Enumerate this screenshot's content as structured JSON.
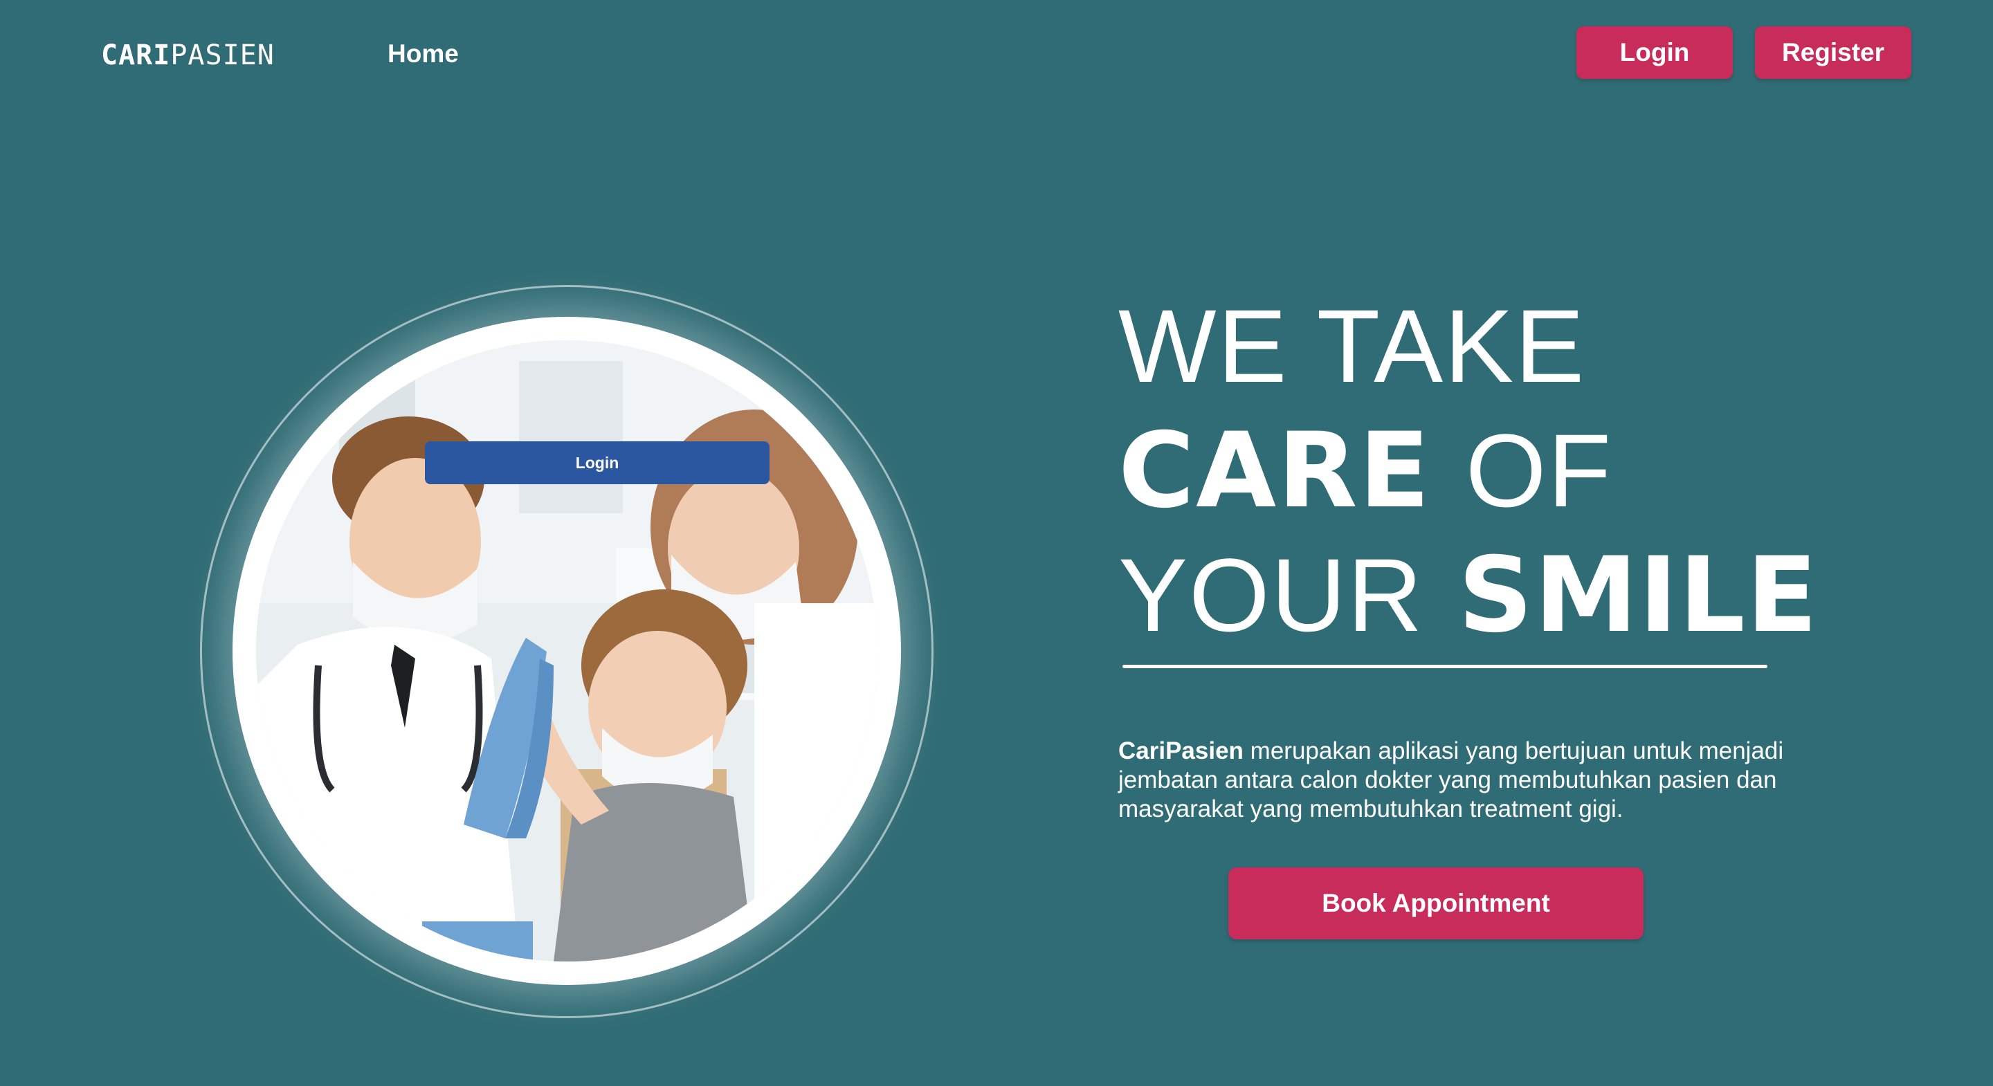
{
  "nav": {
    "logo_bold": "CARI",
    "logo_light": "PASIEN",
    "home_label": "Home",
    "login_label": "Login",
    "register_label": "Register"
  },
  "hero": {
    "photo_login_label": "Login",
    "headline": {
      "line1": "WE TAKE",
      "line2_bold": "CARE",
      "line2_light": "OF",
      "line3_light": "YOUR",
      "line3_bold": "SMILE"
    },
    "description_brand": "CariPasien",
    "description_text": "merupakan aplikasi yang bertujuan untuk menjadi jembatan antara calon dokter yang membutuhkan pasien dan masyarakat yang membutuhkan treatment gigi.",
    "cta_label": "Book Appointment"
  },
  "colors": {
    "background": "#306c75",
    "accent": "#c82c5b",
    "photo_button": "#2b57a0",
    "text": "#ffffff"
  }
}
